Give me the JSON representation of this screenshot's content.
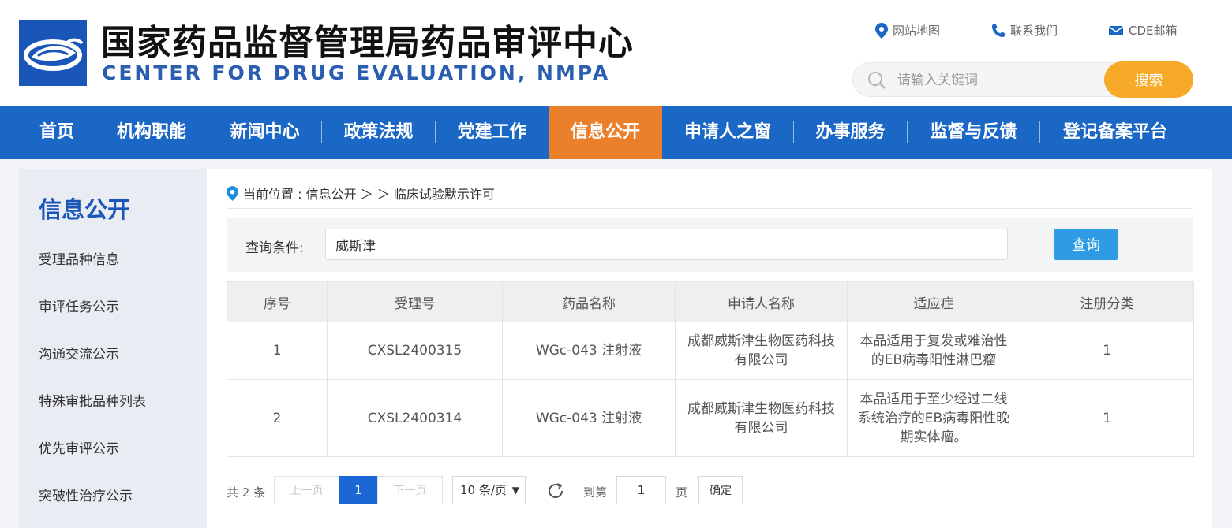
{
  "header": {
    "title_cn": "国家药品监督管理局药品审评中心",
    "title_en": "CENTER FOR DRUG EVALUATION, NMPA",
    "links": {
      "sitemap": "网站地图",
      "contact": "联系我们",
      "mail": "CDE邮箱"
    },
    "search": {
      "placeholder": "请输入关键词",
      "button": "搜索"
    }
  },
  "nav": {
    "items": [
      "首页",
      "机构职能",
      "新闻中心",
      "政策法规",
      "党建工作",
      "信息公开",
      "申请人之窗",
      "办事服务",
      "监督与反馈",
      "登记备案平台"
    ],
    "active": "信息公开"
  },
  "sidebar": {
    "title": "信息公开",
    "items": [
      "受理品种信息",
      "审评任务公示",
      "沟通交流公示",
      "特殊审批品种列表",
      "优先审评公示",
      "突破性治疗公示"
    ]
  },
  "breadcrumb": {
    "text": "当前位置 : 信息公开 ＞ ＞ 临床试验默示许可"
  },
  "query": {
    "label": "查询条件:",
    "value": "威斯津",
    "button": "查询"
  },
  "table": {
    "headers": [
      "序号",
      "受理号",
      "药品名称",
      "申请人名称",
      "适应症",
      "注册分类"
    ],
    "rows": [
      {
        "no": "1",
        "accept_no": "CXSL2400315",
        "drug": "WGc-043 注射液",
        "applicant": "成都威斯津生物医药科技有限公司",
        "indication": "本品适用于复发或难治性的EB病毒阳性淋巴瘤",
        "category": "1"
      },
      {
        "no": "2",
        "accept_no": "CXSL2400314",
        "drug": "WGc-043 注射液",
        "applicant": "成都威斯津生物医药科技有限公司",
        "indication": "本品适用于至少经过二线系统治疗的EB病毒阳性晚期实体瘤。",
        "category": "1"
      }
    ]
  },
  "pager": {
    "total": "共 2 条",
    "prev": "上一页",
    "current": "1",
    "next": "下一页",
    "page_size": "10 条/页",
    "goto": "到第",
    "goto_value": "1",
    "page_unit": "页",
    "confirm": "确定"
  },
  "colors": {
    "nav_blue": "#1a67c5",
    "active_orange": "#ea7f2c",
    "search_orange": "#f7a928",
    "query_blue": "#2d9ce5",
    "logo_blue": "#1a56b8"
  }
}
